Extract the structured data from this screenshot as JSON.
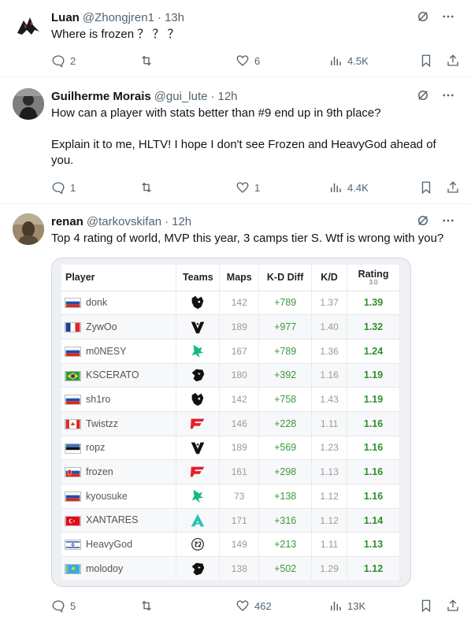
{
  "tweets": [
    {
      "name": "Luan",
      "handle": "@Zhongjren1",
      "time": "13h",
      "text": "Where is frozen ？ ？ ？",
      "replies": "2",
      "reposts": "",
      "likes": "6",
      "views": "4.5K"
    },
    {
      "name": "Guilherme Morais",
      "handle": "@gui_lute",
      "time": "12h",
      "text": "How can a player with stats better than #9 end up in 9th place?\n\nExplain it to me, HLTV! I hope I don't see Frozen and HeavyGod ahead of you.",
      "replies": "1",
      "reposts": "",
      "likes": "1",
      "views": "4.4K"
    },
    {
      "name": "renan",
      "handle": "@tarkovskifan",
      "time": "12h",
      "text": "Top 4 rating of world, MVP this year, 3 camps tier S. Wtf is wrong with you?",
      "replies": "5",
      "reposts": "",
      "likes": "462",
      "views": "13K"
    }
  ],
  "separator": "·",
  "table": {
    "headers": {
      "player": "Player",
      "teams": "Teams",
      "maps": "Maps",
      "diff": "K-D Diff",
      "kd": "K/D",
      "rating": "Rating",
      "rating_sub": "3.0"
    },
    "rows": [
      {
        "player": "donk",
        "flag": "russia",
        "team": "team-spirit",
        "maps": "142",
        "diff": "+789",
        "kd": "1.37",
        "rating": "1.39"
      },
      {
        "player": "ZywOo",
        "flag": "france",
        "team": "vitality",
        "maps": "189",
        "diff": "+977",
        "kd": "1.40",
        "rating": "1.32"
      },
      {
        "player": "m0NESY",
        "flag": "russia",
        "team": "falcons",
        "maps": "167",
        "diff": "+789",
        "kd": "1.36",
        "rating": "1.24"
      },
      {
        "player": "KSCERATO",
        "flag": "brazil",
        "team": "furia",
        "maps": "180",
        "diff": "+392",
        "kd": "1.16",
        "rating": "1.19"
      },
      {
        "player": "sh1ro",
        "flag": "russia",
        "team": "team-spirit",
        "maps": "142",
        "diff": "+758",
        "kd": "1.43",
        "rating": "1.19"
      },
      {
        "player": "Twistzz",
        "flag": "canada",
        "team": "faze",
        "maps": "146",
        "diff": "+228",
        "kd": "1.11",
        "rating": "1.16"
      },
      {
        "player": "ropz",
        "flag": "estonia",
        "team": "vitality",
        "maps": "189",
        "diff": "+569",
        "kd": "1.23",
        "rating": "1.16"
      },
      {
        "player": "frozen",
        "flag": "slovakia",
        "team": "faze",
        "maps": "161",
        "diff": "+298",
        "kd": "1.13",
        "rating": "1.16"
      },
      {
        "player": "kyousuke",
        "flag": "russia",
        "team": "falcons",
        "maps": "73",
        "diff": "+138",
        "kd": "1.12",
        "rating": "1.16"
      },
      {
        "player": "XANTARES",
        "flag": "turkey",
        "team": "aurora",
        "maps": "171",
        "diff": "+316",
        "kd": "1.12",
        "rating": "1.14"
      },
      {
        "player": "HeavyGod",
        "flag": "israel",
        "team": "g2",
        "maps": "149",
        "diff": "+213",
        "kd": "1.11",
        "rating": "1.13"
      },
      {
        "player": "molodoy",
        "flag": "kazakhstan",
        "team": "furia",
        "maps": "138",
        "diff": "+502",
        "kd": "1.29",
        "rating": "1.12"
      }
    ]
  },
  "colors": {
    "text_primary": "#0f1419",
    "text_secondary": "#536471",
    "rating_green": "#2f8f2f"
  }
}
